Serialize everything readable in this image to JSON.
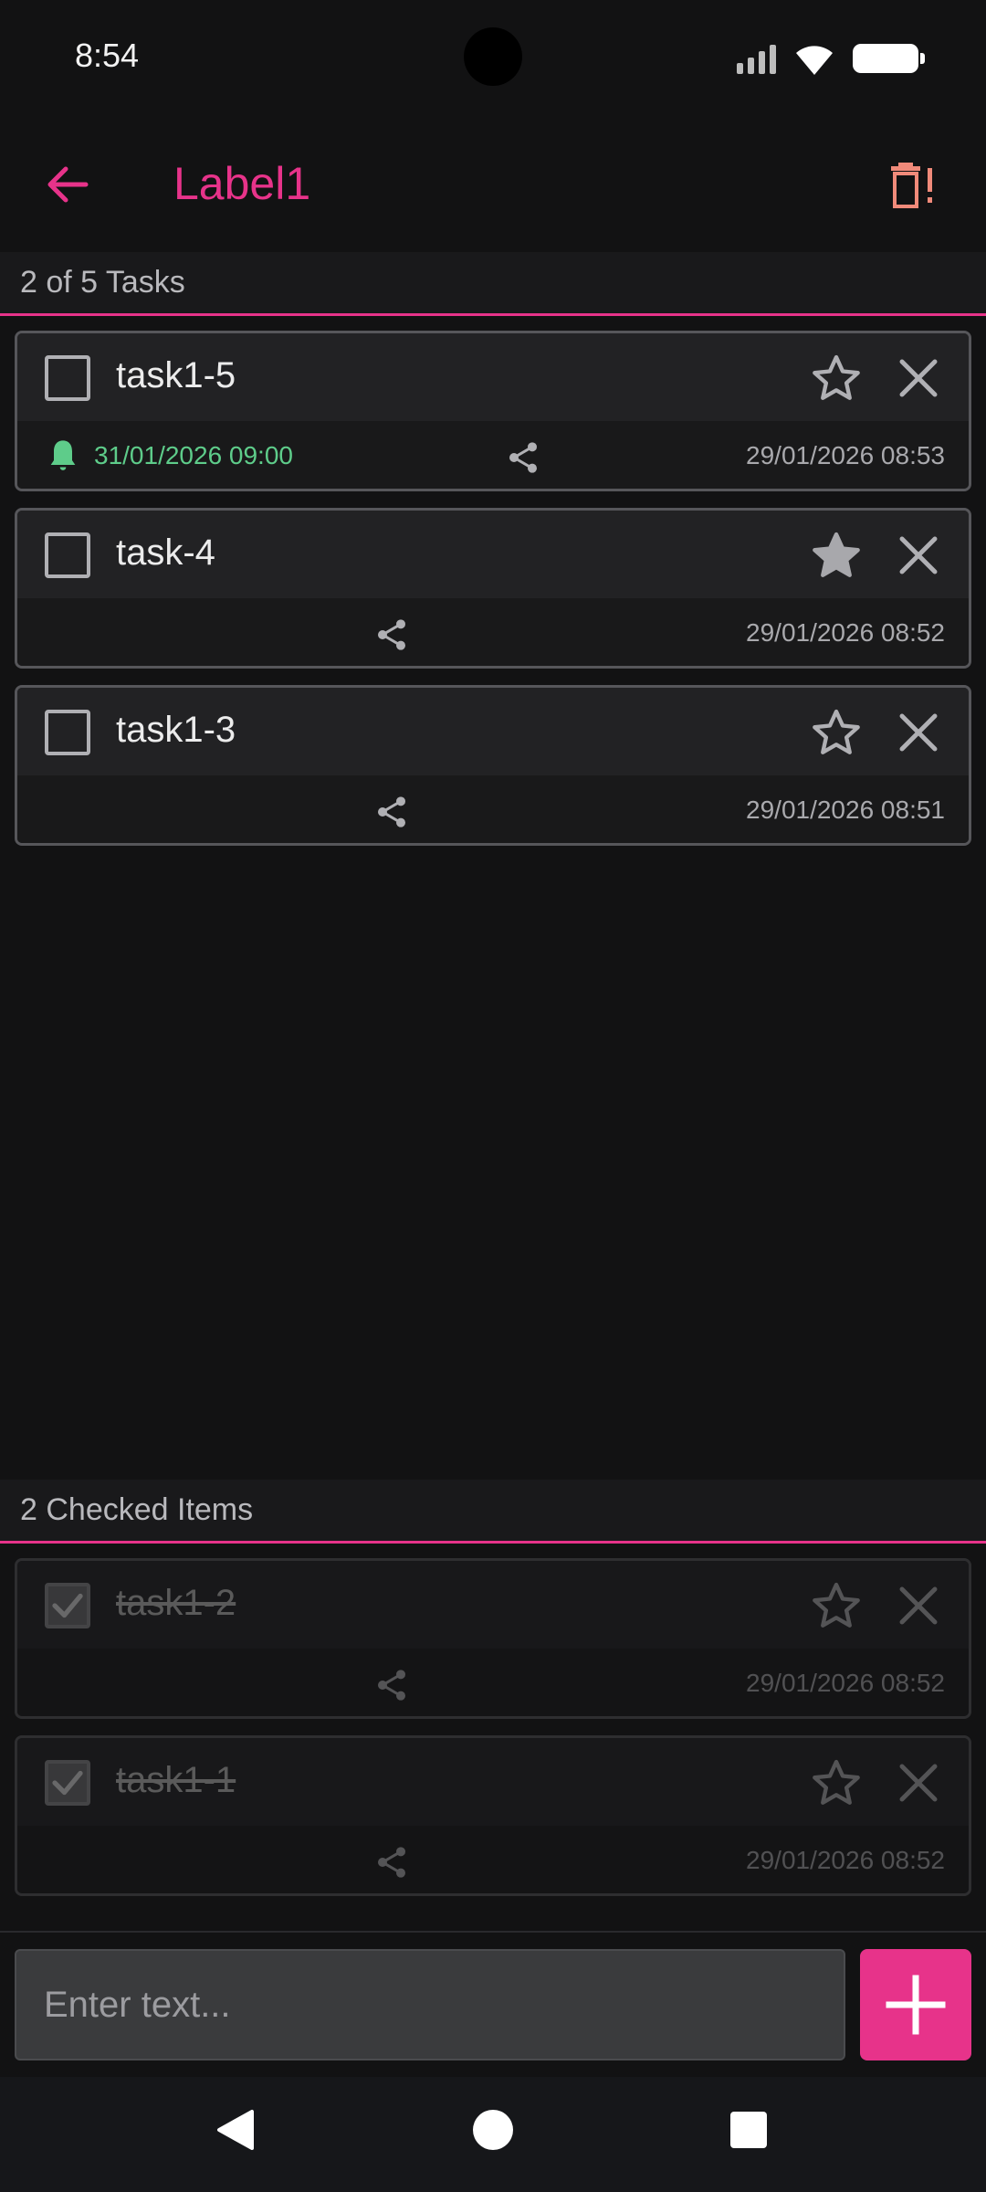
{
  "status_bar": {
    "time": "8:54"
  },
  "app_bar": {
    "title": "Label1"
  },
  "pending_section": {
    "header": "2 of 5 Tasks"
  },
  "pending_tasks": [
    {
      "title": "task1-5",
      "starred": false,
      "alarm": "31/01/2026 09:00",
      "timestamp": "29/01/2026 08:53"
    },
    {
      "title": "task-4",
      "starred": true,
      "alarm": "",
      "timestamp": "29/01/2026 08:52"
    },
    {
      "title": "task1-3",
      "starred": false,
      "alarm": "",
      "timestamp": "29/01/2026 08:51"
    }
  ],
  "checked_section": {
    "header": "2 Checked Items"
  },
  "checked_tasks": [
    {
      "title": "task1-2",
      "starred": false,
      "timestamp": "29/01/2026 08:52"
    },
    {
      "title": "task1-1",
      "starred": false,
      "timestamp": "29/01/2026 08:52"
    }
  ],
  "input": {
    "placeholder": "Enter text...",
    "value": ""
  },
  "colors": {
    "accent": "#e7338a",
    "alarm": "#5ecc8a",
    "delete_icon": "#f08a7a",
    "background": "#121213"
  },
  "icons": {
    "back": "arrow-left-icon",
    "delete": "delete-all-icon",
    "star": "star-icon",
    "close": "close-icon",
    "share": "share-icon",
    "bell": "bell-icon",
    "add": "plus-icon"
  }
}
